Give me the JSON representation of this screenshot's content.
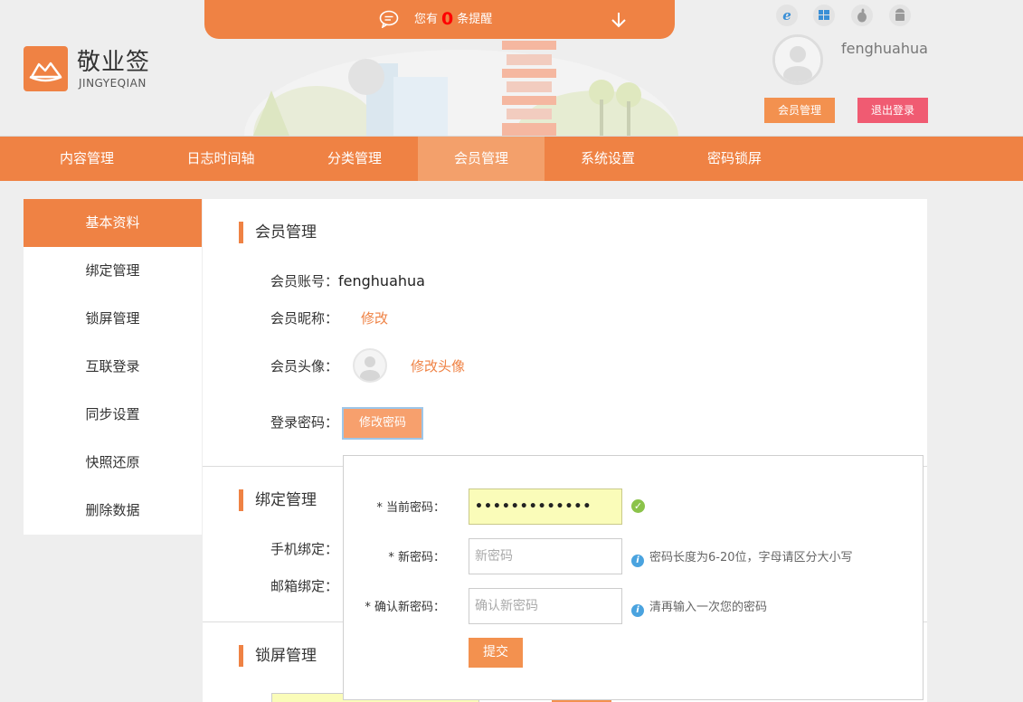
{
  "topbar": {
    "prefix": "您有",
    "count": "0",
    "suffix": "条提醒"
  },
  "brand": {
    "title": "敬业签",
    "subtitle": "JINGYEQIAN",
    "accent": "#ef8244"
  },
  "user": {
    "name": "fenghuahua",
    "member_btn": "会员管理",
    "logout_btn": "退出登录"
  },
  "os_icons": [
    "ie-icon",
    "windows-icon",
    "apple-icon",
    "android-icon"
  ],
  "nav": {
    "items": [
      "内容管理",
      "日志时间轴",
      "分类管理",
      "会员管理",
      "系统设置",
      "密码锁屏"
    ],
    "active": "会员管理"
  },
  "sidebar": {
    "items": [
      "基本资料",
      "绑定管理",
      "锁屏管理",
      "互联登录",
      "同步设置",
      "快照还原",
      "删除数据"
    ],
    "active": "基本资料"
  },
  "profile": {
    "section_title": "会员管理",
    "account_label": "会员账号：",
    "account_value": "fenghuahua",
    "nickname_label": "会员昵称：",
    "nickname_link": "修改",
    "avatar_label": "会员头像：",
    "avatar_link": "修改头像",
    "password_label": "登录密码：",
    "password_btn": "修改密码"
  },
  "binding": {
    "section_title": "绑定管理",
    "phone_label": "手机绑定：",
    "email_label": "邮箱绑定："
  },
  "lock": {
    "section_title": "锁屏管理"
  },
  "pwd_form": {
    "current_label": "* 当前密码：",
    "current_value": "•••••••••••••",
    "new_label": "* 新密码：",
    "new_placeholder": "新密码",
    "new_hint": "密码长度为6-20位，字母请区分大小写",
    "confirm_label": "* 确认新密码：",
    "confirm_placeholder": "确认新密码",
    "confirm_hint": "清再输入一次您的密码",
    "submit": "提交"
  }
}
